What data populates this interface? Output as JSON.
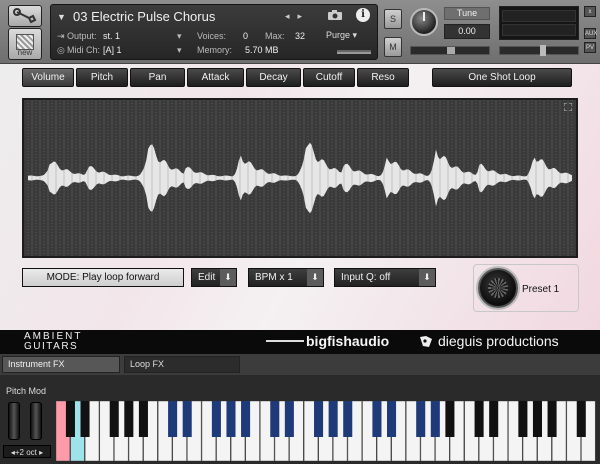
{
  "header": {
    "instrument_name": "03 Electric Pulse Chorus",
    "output_label": "Output:",
    "output_value": "st. 1",
    "voices_label": "Voices:",
    "voices_value": "0",
    "max_label": "Max:",
    "max_value": "32",
    "midi_label": "Midi Ch:",
    "midi_value": "[A]  1",
    "memory_label": "Memory:",
    "memory_value": "5.70 MB",
    "purge_label": "Purge",
    "new_label": "new",
    "s_label": "S",
    "m_label": "M",
    "tune_label": "Tune",
    "tune_value": "0.00",
    "close_label": "x",
    "aux_label": "AUX",
    "pv_label": "PV"
  },
  "tabs": [
    {
      "label": "Volume",
      "active": true
    },
    {
      "label": "Pitch",
      "active": false
    },
    {
      "label": "Pan",
      "active": false
    },
    {
      "label": "Attack",
      "active": false
    },
    {
      "label": "Decay",
      "active": false
    },
    {
      "label": "Cutoff",
      "active": false
    },
    {
      "label": "Reso",
      "active": false
    }
  ],
  "one_shot_label": "One Shot Loop",
  "controls": {
    "mode_label": "MODE: Play loop forward",
    "edit_label": "Edit",
    "bpm_label": "BPM x 1",
    "inputq_label": "Input Q: off",
    "preset_label": "Preset 1"
  },
  "waveform": {
    "bursts": [
      {
        "pos": 0.04,
        "amp": 0.3
      },
      {
        "pos": 0.11,
        "amp": 0.2
      },
      {
        "pos": 0.22,
        "amp": 0.6
      },
      {
        "pos": 0.29,
        "amp": 0.18
      },
      {
        "pos": 0.39,
        "amp": 0.38
      },
      {
        "pos": 0.51,
        "amp": 0.64
      },
      {
        "pos": 0.58,
        "amp": 0.24
      },
      {
        "pos": 0.66,
        "amp": 0.36
      },
      {
        "pos": 0.75,
        "amp": 0.48
      },
      {
        "pos": 0.83,
        "amp": 0.22
      },
      {
        "pos": 0.93,
        "amp": 0.4
      }
    ],
    "wave_color": "#e6e6e6",
    "bg_color": "#3a3a3a",
    "grid_color": "#5a5a5a"
  },
  "branding": {
    "ambient_line1": "AMBIENT",
    "ambient_line2": "GUITARS",
    "bigfish": "bigfishaudio",
    "dieguis": "dieguis productions"
  },
  "fx_tabs": [
    {
      "label": "Instrument FX",
      "active": true
    },
    {
      "label": "Loop FX",
      "active": false
    }
  ],
  "keyboard": {
    "pitch_mod_label": "Pitch Mod",
    "octave_label": "◂+2 oct ▸",
    "white_key_count": 37,
    "mapped_color": "#1e3a78",
    "pink_color": "#ff9aa8",
    "cyan_color": "#9fe3ea"
  },
  "colors": {
    "accent": "#e24b4b"
  }
}
